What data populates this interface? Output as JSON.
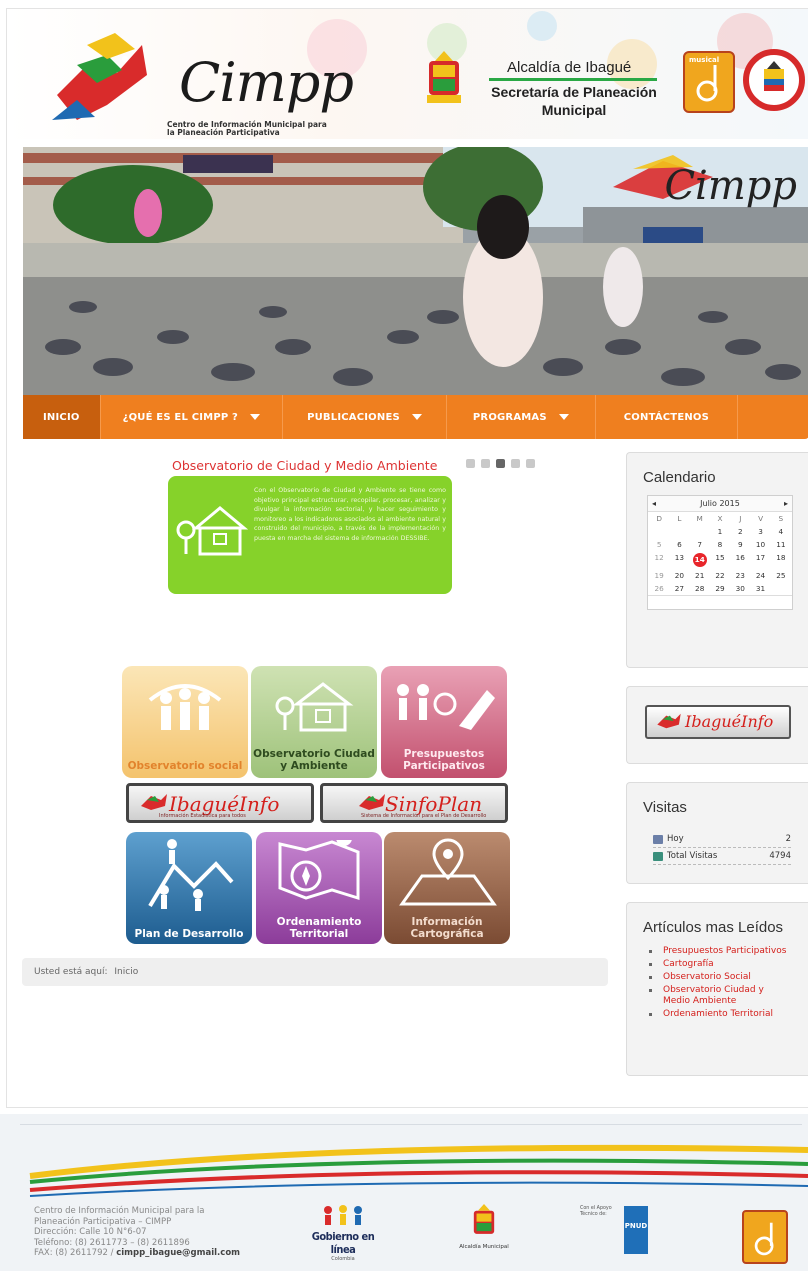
{
  "header": {
    "logo_text": "Cimpp",
    "logo_subtitle": "Centro de Información Municipal para la Planeación Participativa",
    "alcaldia": "Alcaldía de Ibagué",
    "secretaria": "Secretaría de Planeación Municipal",
    "musical_label": "musical",
    "banner_watermark": "Cimpp"
  },
  "nav": {
    "items": [
      {
        "label": "INICIO",
        "active": true
      },
      {
        "label": "¿QUÉ ES EL CIMPP ?",
        "dropdown": true
      },
      {
        "label": "PUBLICACIONES",
        "dropdown": true
      },
      {
        "label": "PROGRAMAS",
        "dropdown": true
      },
      {
        "label": "CONTÁCTENOS"
      }
    ]
  },
  "slider": {
    "title": "Observatorio de Ciudad y Medio Ambiente",
    "text": "Con el Observatorio de Ciudad y Ambiente se tiene como objetivo principal estructurar, recopilar, procesar, analizar y divulgar la información sectorial, y hacer seguimiento y monitoreo a los indicadores asociados al ambiente natural y construido del municipio, a través de la implementación y puesta en marcha del sistema de información DESSIBE.",
    "dot_count": 5,
    "active_dot": 3
  },
  "tiles": {
    "observatorio_social": "Observatorio social",
    "observatorio_ciudad": "Observatorio Ciudad y Ambiente",
    "presupuestos": "Presupuestos Participativos",
    "ibague_info": "IbaguéInfo",
    "ibague_info_sub": "Información Estadística para todos",
    "sinfoplan": "SinfoPlan",
    "sinfoplan_sub": "Sistema de Información para el Plan de Desarrollo",
    "plan_desarrollo": "Plan de Desarrollo",
    "ordenamiento": "Ordenamiento Territorial",
    "cartografica": "Información Cartográfica"
  },
  "breadcrumb": {
    "prefix": "Usted está aquí:",
    "current": "Inicio"
  },
  "calendar": {
    "heading": "Calendario",
    "prev": "◂",
    "next": "▸",
    "month": "Julio 2015",
    "day_headers": [
      "D",
      "L",
      "M",
      "X",
      "J",
      "V",
      "S"
    ],
    "weeks": [
      [
        "",
        "",
        "",
        "1",
        "2",
        "3",
        "4"
      ],
      [
        "5",
        "6",
        "7",
        "8",
        "9",
        "10",
        "11"
      ],
      [
        "12",
        "13",
        "14",
        "15",
        "16",
        "17",
        "18"
      ],
      [
        "19",
        "20",
        "21",
        "22",
        "23",
        "24",
        "25"
      ],
      [
        "26",
        "27",
        "28",
        "29",
        "30",
        "31",
        ""
      ]
    ],
    "today": "14"
  },
  "sidebar_ibague": "IbaguéInfo",
  "visits": {
    "heading": "Visitas",
    "rows": [
      {
        "label": "Hoy",
        "value": "2"
      },
      {
        "label": "Total Visitas",
        "value": "4794"
      }
    ]
  },
  "most_read": {
    "heading": "Artículos mas Leídos",
    "items": [
      "Presupuestos Participativos",
      "Cartografía",
      "Observatorio Social",
      "Observatorio Ciudad y Medio Ambiente",
      "Ordenamiento Territorial"
    ]
  },
  "footer": {
    "line1": "Centro de Información Municipal para la",
    "line2": "Planeación Participativa – CIMPP",
    "line3": "Dirección: Calle 10 N°6-07",
    "line4": "Teléfono: (8) 2611773 – (8) 2611896",
    "line5_prefix": "FAX: (8) 2611792 /",
    "email": "cimpp_ibague@gmail.com",
    "gobierno": "Gobierno en línea",
    "gobierno_sub": "Colombia",
    "alcaldia": "Alcaldía Municipal",
    "undp_note": "Con el Apoyo Técnico de:",
    "undp": "PNUD"
  },
  "colors": {
    "nav": "#ef7f1f",
    "nav_active": "#c75f0e",
    "accent_red": "#d4201c",
    "slide_green": "#86d22a"
  }
}
